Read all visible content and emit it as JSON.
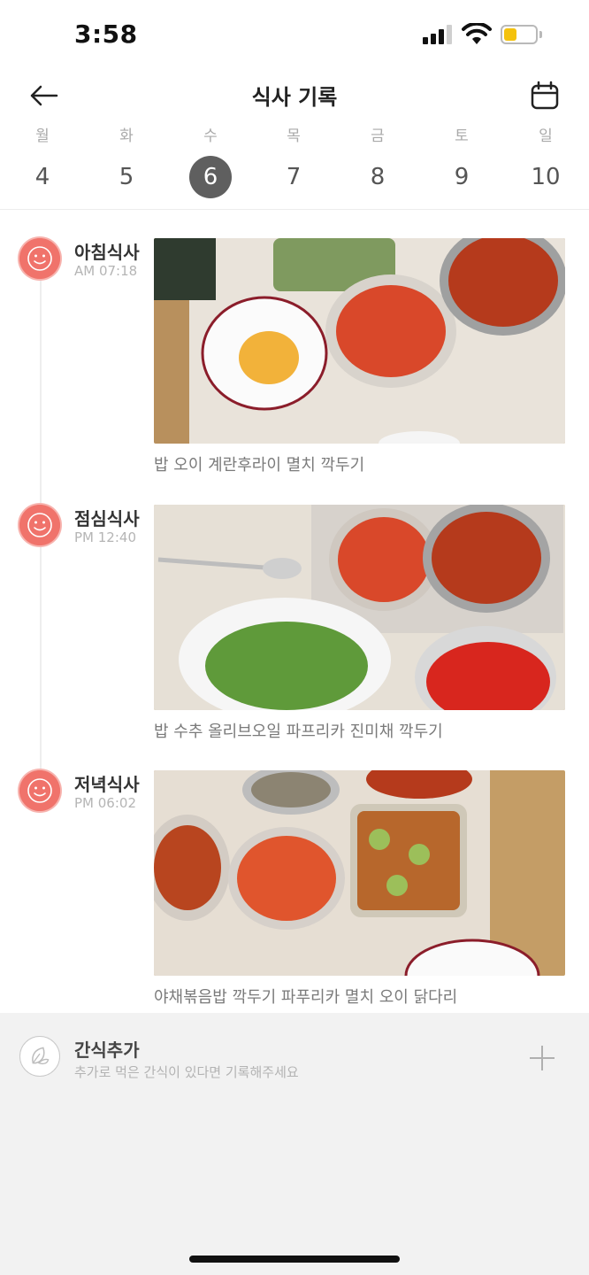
{
  "status_bar": {
    "time": "3:58"
  },
  "header": {
    "title": "식사 기록",
    "back_icon": "back-arrow-icon",
    "calendar_icon": "calendar-icon"
  },
  "week": {
    "days": [
      {
        "name": "월",
        "num": "4"
      },
      {
        "name": "화",
        "num": "5"
      },
      {
        "name": "수",
        "num": "6"
      },
      {
        "name": "목",
        "num": "7"
      },
      {
        "name": "금",
        "num": "8"
      },
      {
        "name": "토",
        "num": "9"
      },
      {
        "name": "일",
        "num": "10"
      }
    ],
    "selected": "6"
  },
  "meals": [
    {
      "name": "아침식사",
      "time": "AM 07:18",
      "desc": "밥 오이 계란후라이 멸치 깍두기",
      "icon": "smile-icon"
    },
    {
      "name": "점심식사",
      "time": "PM 12:40",
      "desc": "밥 수추 올리브오일 파프리카 진미채 깍두기",
      "icon": "smile-icon"
    },
    {
      "name": "저녁식사",
      "time": "PM 06:02",
      "desc": "야채볶음밥 깍두기 파푸리카 멸치 오이 닭다리",
      "icon": "smile-icon"
    }
  ],
  "snack": {
    "title": "간식추가",
    "subtitle": "추가로 먹은 간식이 있다면 기록해주세요",
    "icon": "leaf-icon",
    "add_icon": "plus-icon"
  },
  "colors": {
    "accent": "#f0736b",
    "selected_day": "#5f5f5f"
  }
}
